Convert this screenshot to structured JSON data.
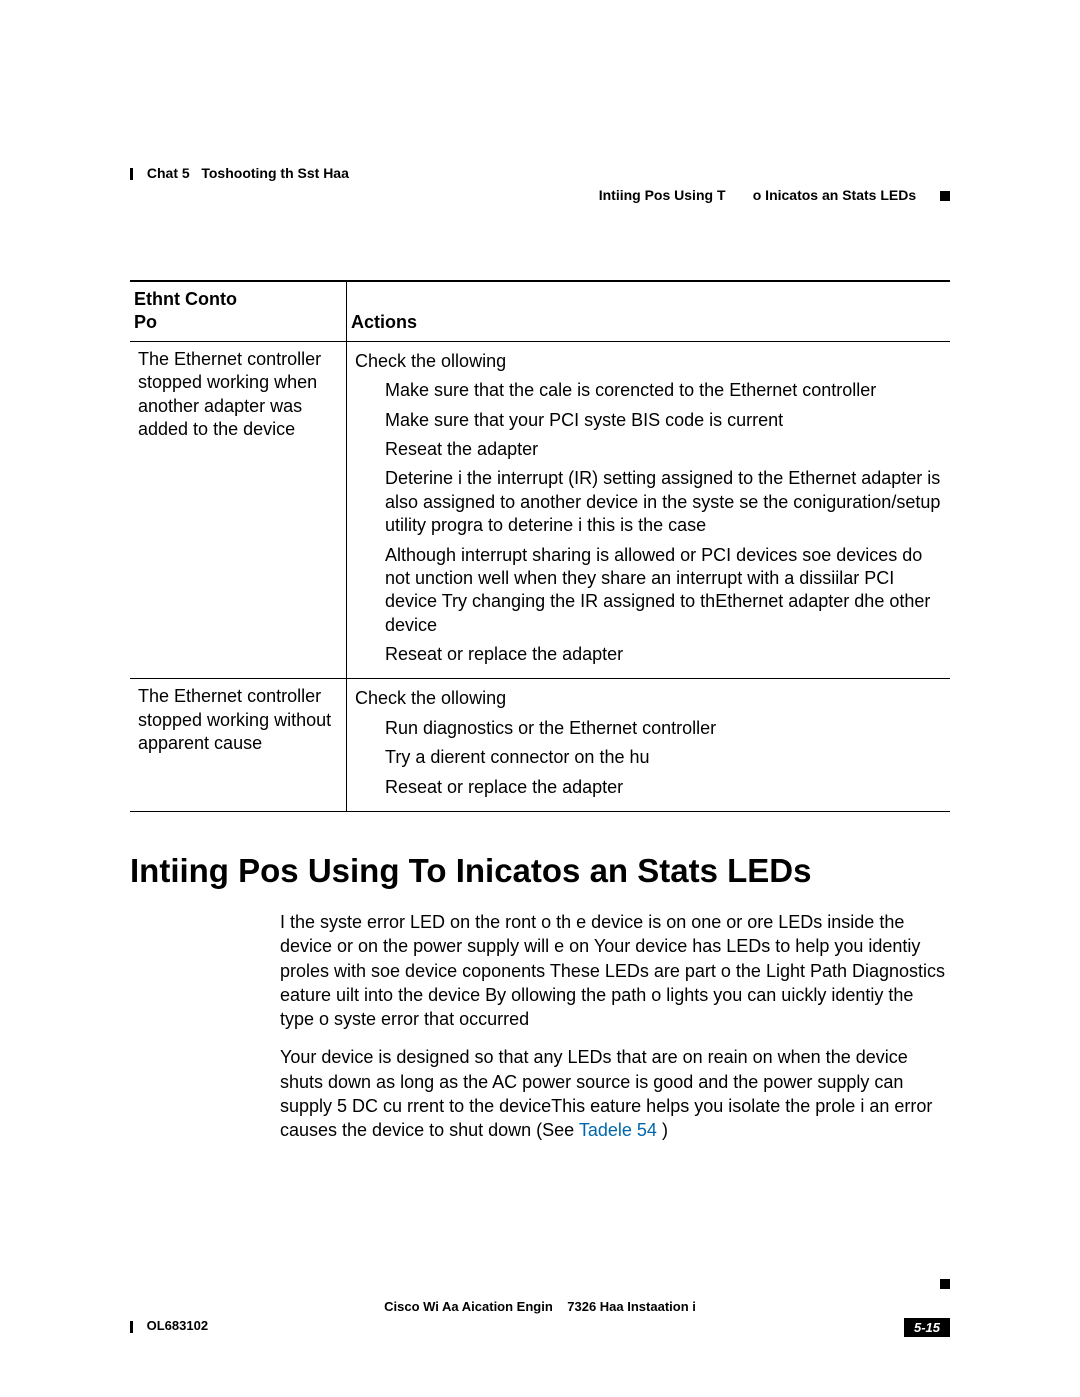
{
  "header": {
    "chapter_label": "Chat 5",
    "chapter_title": "Toshooting th Sst Haa",
    "right_left": "Intiing Pos Using T",
    "right_right": "o Inicatos an Stats LEDs"
  },
  "table": {
    "head_col1_l1": "Ethnt Conto",
    "head_col1_l2": "Po",
    "head_col2": "Actions",
    "rows": [
      {
        "problem": "The Ethernet controller stopped working when another adapter was added to the device",
        "lead": "Check the ollowing",
        "items": [
          "Make sure that the cale is corencted to the Ethernet controller",
          "Make sure that your PCI syste BIS code is current",
          "Reseat the adapter",
          "Deterine i the interrupt (IR) setting assigned to the Ethernet adapter is also assigned to another device in the syste se the coniguration/setup utility progra to deterine i this is the case",
          "Although interrupt sharing is allowed or PCI devices soe devices do not unction well when they share an interrupt with a dissiilar PCI device Try changing the IR assigned to thEthernet adapter dhe other device",
          "Reseat or replace the adapter"
        ]
      },
      {
        "problem": "The Ethernet controller stopped working without apparent cause",
        "lead": "Check the ollowing",
        "items": [
          "Run diagnostics or the Ethernet controller",
          "Try a dierent connector on the hu",
          "Reseat or replace the adapter"
        ]
      }
    ]
  },
  "section": {
    "title": "Intiing Pos Using To Inicatos an Stats LEDs",
    "p1": "I the syste error LED on the ront o th e device is on one or ore LEDs inside the device or on the power supply will e on Your device has LEDs to help you identiy proles with soe device coponents These LEDs are part o the Light Path Diagnostics eature uilt into the device By ollowing the path o lights you can uickly identiy the type o syste error that occurred",
    "p2a": "Your device is designed so that any LEDs that are on reain on when the device shuts down as long as the AC power source is good and the power supply can supply 5 DC cu  rrent to the deviceThis eature helps you isolate the prole i an error causes the device to shut down (See",
    "p2_link": "Tadele 54",
    "p2b": ")"
  },
  "footer": {
    "center_left": "Cisco Wi Aa Aication Engin",
    "center_right": "7326 Haa Instaation i",
    "doc": "OL683102",
    "page": "5-15"
  }
}
